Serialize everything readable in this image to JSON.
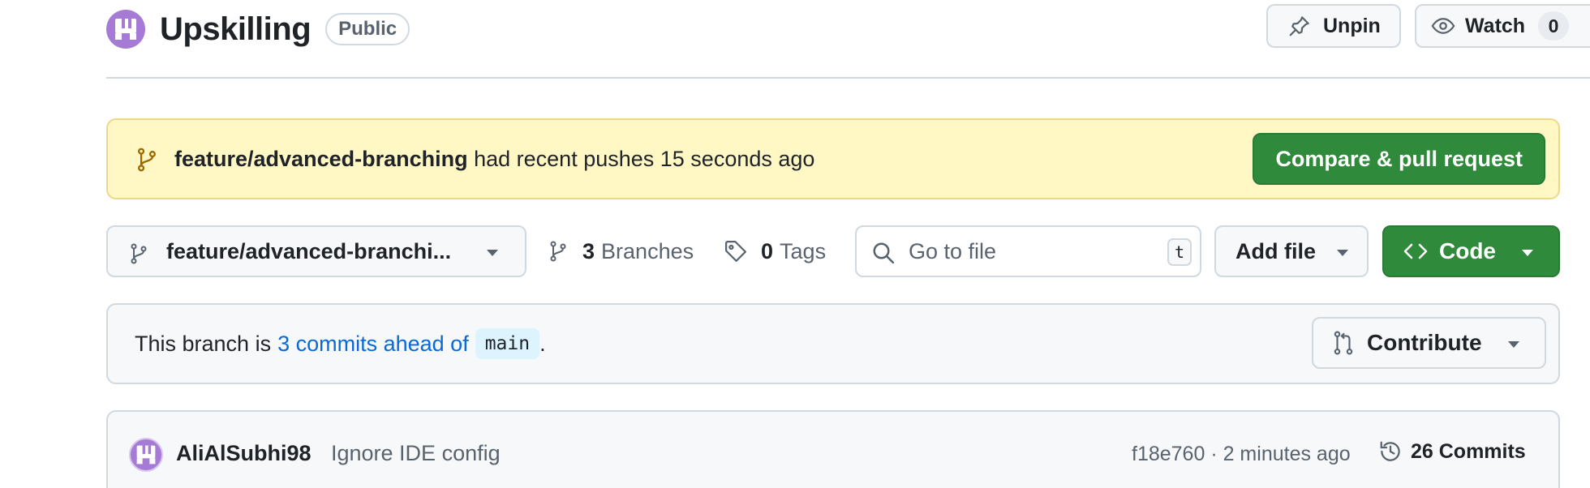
{
  "repo": {
    "name": "Upskilling",
    "visibility": "Public"
  },
  "header_actions": {
    "unpin_label": "Unpin",
    "watch_label": "Watch",
    "watch_count": "0"
  },
  "banner": {
    "branch": "feature/advanced-branching",
    "message": "had recent pushes 15 seconds ago",
    "compare_label": "Compare & pull request"
  },
  "toolbar": {
    "branch_label": "feature/advanced-branchi...",
    "branches_count": "3",
    "branches_label": "Branches",
    "tags_count": "0",
    "tags_label": "Tags",
    "goto_placeholder": "Go to file",
    "goto_shortcut": "t",
    "add_file_label": "Add file",
    "code_label": "Code"
  },
  "ahead": {
    "prefix": "This branch is",
    "link": "3 commits ahead of",
    "base": "main",
    "suffix": ".",
    "contribute_label": "Contribute"
  },
  "latest_commit": {
    "author": "AliAlSubhi98",
    "message": "Ignore IDE config",
    "meta": "f18e760 · 2 minutes ago",
    "commits_label": "26 Commits"
  },
  "colors": {
    "primary_green": "#2f8a3b",
    "banner_yellow": "#fff8c5",
    "link_blue": "#0969da",
    "avatar_purple": "#a57bd6"
  },
  "icons": {
    "repo_avatar": "identicon-icon",
    "unpin": "pin-icon",
    "watch": "eye-icon",
    "branch": "git-branch-icon",
    "tag": "tag-icon",
    "search": "search-icon",
    "code": "code-icon",
    "contribute": "git-pull-request-icon",
    "history": "history-icon"
  }
}
